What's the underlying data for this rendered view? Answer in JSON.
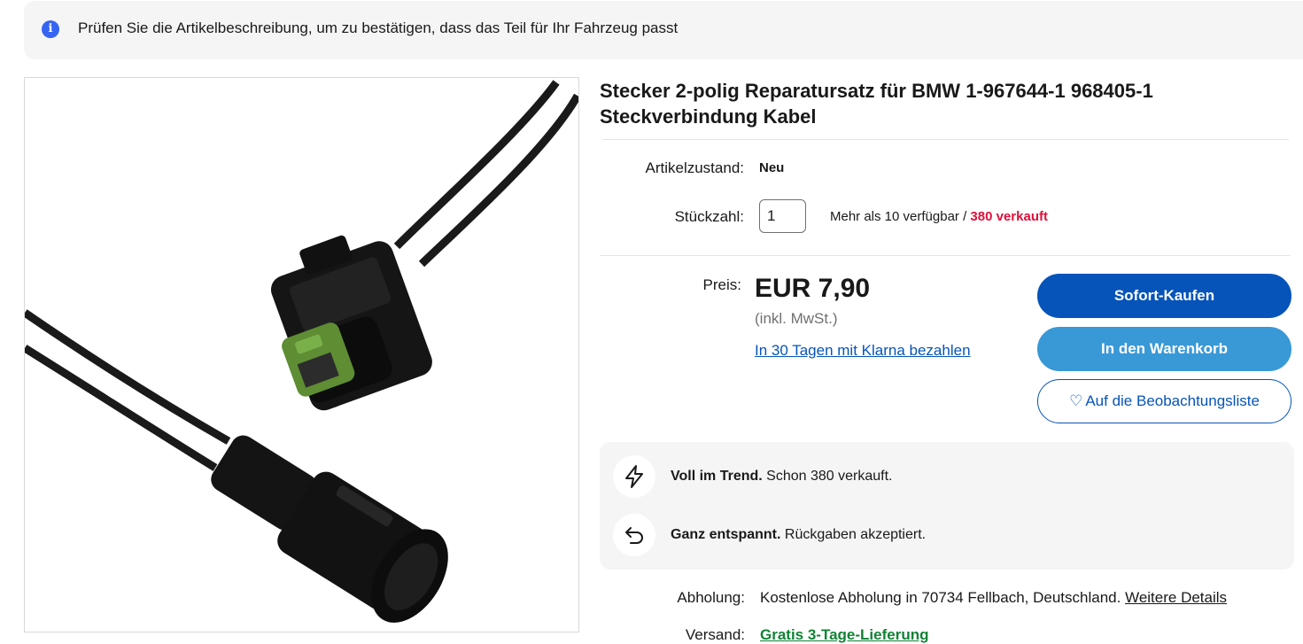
{
  "notice": {
    "icon": "info-icon",
    "text": "Prüfen Sie die Artikelbeschreibung, um zu bestätigen, dass das Teil für Ihr Fahrzeug passt"
  },
  "product": {
    "title": "Stecker 2-polig Reparatursatz für BMW 1-967644-1 968405-1 Steckverbindung Kabel",
    "condition_label": "Artikelzustand:",
    "condition_value": "Neu",
    "quantity_label": "Stückzahl:",
    "quantity_value": "1",
    "availability": "Mehr als 10 verfügbar / ",
    "sold": "380 verkauft",
    "price_label": "Preis:",
    "price": "EUR 7,90",
    "vat_note": "(inkl. MwSt.)",
    "klarna_link": "In 30 Tagen mit Klarna bezahlen"
  },
  "actions": {
    "buy_now": "Sofort-Kaufen",
    "add_to_cart": "In den Warenkorb",
    "watchlist": "Auf die Beobachtungsliste"
  },
  "highlights": [
    {
      "icon": "lightning-icon",
      "bold": "Voll im Trend.",
      "text": " Schon 380 verkauft."
    },
    {
      "icon": "return-arrow-icon",
      "bold": "Ganz entspannt.",
      "text": " Rückgaben akzeptiert."
    }
  ],
  "pickup": {
    "label": "Abholung:",
    "value": "Kostenlose Abholung in 70734 Fellbach, Deutschland. ",
    "details_link": "Weitere Details"
  },
  "shipping": {
    "label": "Versand:",
    "value": "Gratis 3-Tage-Lieferung"
  },
  "colors": {
    "primary_blue": "#0654ba",
    "cart_blue": "#3998d6",
    "sold_red": "#e0103a",
    "shipping_green": "#118236"
  }
}
